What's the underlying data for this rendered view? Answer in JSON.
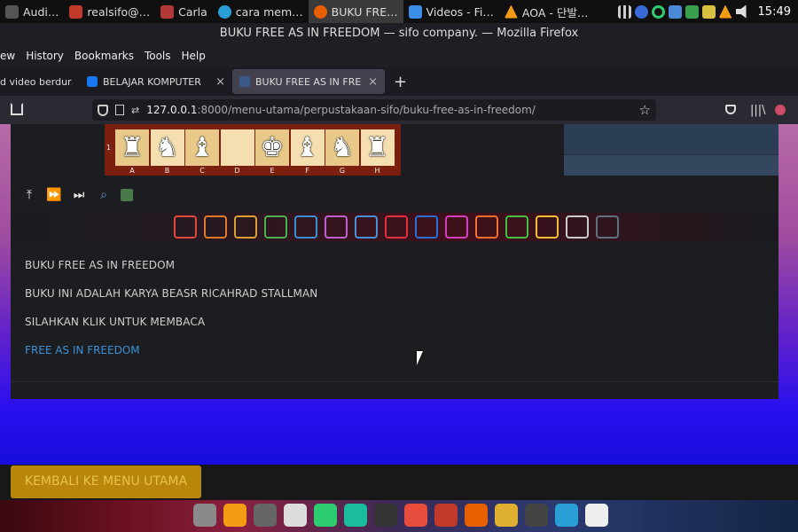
{
  "taskbar": {
    "tasks": [
      {
        "label": "Audi…",
        "color": "#555555"
      },
      {
        "label": "realsifo@…",
        "color": "#c0392b"
      },
      {
        "label": "Carla",
        "color": "#b33939"
      },
      {
        "label": "cara mem…",
        "color": "#2a9fd6"
      },
      {
        "label": "BUKU FRE…",
        "color": "#e66000"
      },
      {
        "label": "Videos - Fi…",
        "color": "#3b8ee6"
      },
      {
        "label": "AOA - 단발…",
        "color": "#f39c12"
      }
    ],
    "clock": "15:49",
    "tray_icons": [
      "signal-icon",
      "bluetooth-icon",
      "sync-icon",
      "network-icon",
      "shield-icon",
      "tool-icon",
      "vlc-icon",
      "volume-icon"
    ]
  },
  "window": {
    "title": "BUKU FREE AS IN FREEDOM — sifo company. — Mozilla Firefox"
  },
  "menubar": [
    "ew",
    "History",
    "Bookmarks",
    "Tools",
    "Help"
  ],
  "tabs": [
    {
      "label": "d video berdur…",
      "active": false
    },
    {
      "label": "BELAJAR KOMPUTER",
      "active": false
    },
    {
      "label": "BUKU FREE AS IN FREEDOM",
      "active": true
    }
  ],
  "navbar": {
    "url_host": "127.0.0.1",
    "url_path": ":8000/menu-utama/perpustakaan-sifo/buku-free-as-in-freedom/"
  },
  "chessboard": {
    "rank": "1",
    "files": [
      "A",
      "B",
      "C",
      "D",
      "E",
      "F",
      "G",
      "H"
    ],
    "pieces": [
      "♜",
      "♞",
      "♝",
      "",
      "♚",
      "♝",
      "♞",
      "♜"
    ]
  },
  "content": {
    "lines": [
      "BUKU FREE AS IN FREEDOM",
      "BUKU INI ADALAH KARYA BEASR RICAHRAD STALLMAN",
      "SILAHKAN KLIK UNTUK MEMBACA"
    ],
    "link": "FREE AS IN FREEDOM"
  },
  "back_button": "KEMBALI KE MENU UTAMA",
  "app_strip_colors": [
    "#e0483a",
    "#e07a2a",
    "#d8a030",
    "#4caf50",
    "#3a8fd6",
    "#c060d0",
    "#4a90d9",
    "#e03040",
    "#2a6fd6",
    "#d040c0",
    "#f07030",
    "#40c040",
    "#f0c030",
    "#cccccc",
    "#607080"
  ],
  "dock_colors": [
    "#8a8a8a",
    "#f39c12",
    "#666666",
    "#dddddd",
    "#2ecc71",
    "#1abc9c",
    "#333333",
    "#e74c3c",
    "#c0392b",
    "#e66000",
    "#e0b030",
    "#444444",
    "#2a9fd6",
    "#eeeeee"
  ]
}
